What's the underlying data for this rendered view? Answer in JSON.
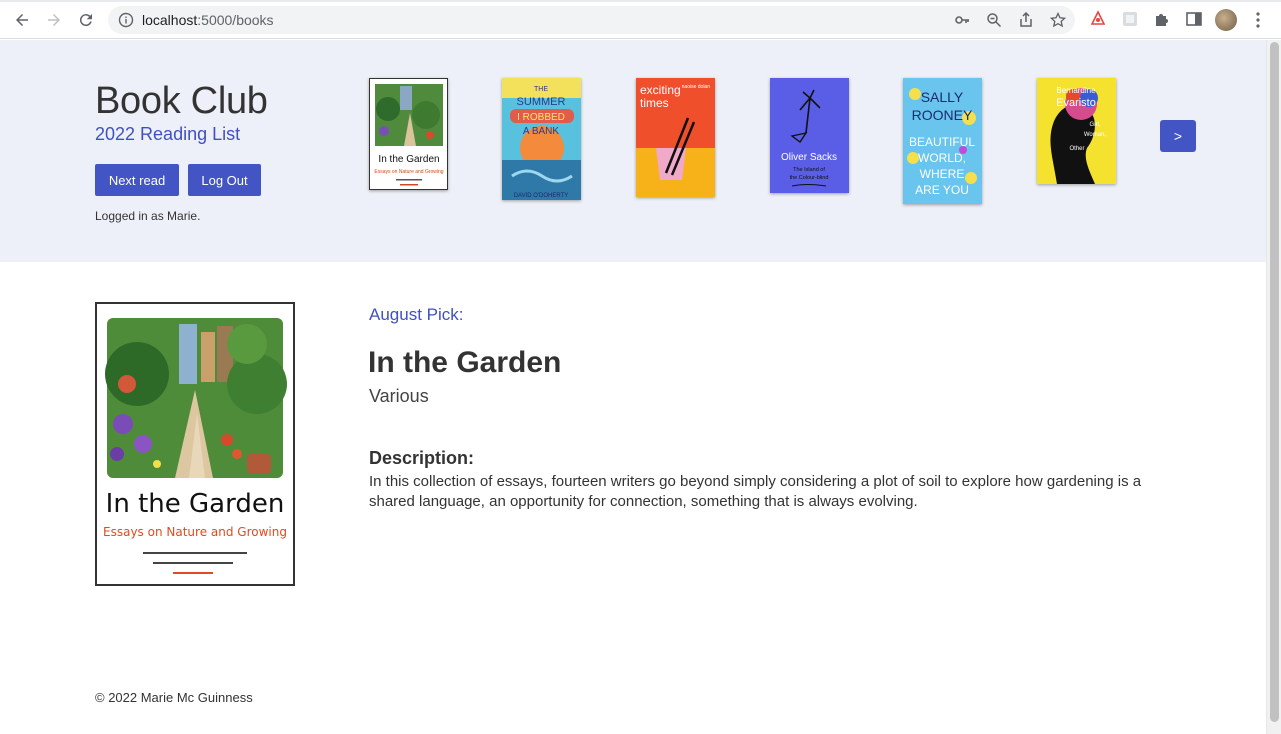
{
  "browser": {
    "url_host": "localhost",
    "url_path": ":5000/books"
  },
  "header": {
    "title": "Book Club",
    "subtitle": "2022 Reading List",
    "next_read_label": "Next read",
    "logout_label": "Log Out",
    "logged_in_text": "Logged in as Marie.",
    "carousel_next_label": ">"
  },
  "carousel": {
    "covers": [
      {
        "title_art": "In the Garden",
        "subtitle_art": "Essays on Nature and Growing"
      },
      {
        "title_art": "THE SUMMER I ROBBED A BANK",
        "author_art": "DAVID O'DOHERTY"
      },
      {
        "title_art": "exciting times",
        "author_art": "naoise dolan"
      },
      {
        "title_art": "Oliver Sacks",
        "subtitle_art": "The Island of the Colour-blind"
      },
      {
        "title_art": "SALLY ROONEY BEAUTIFUL WORLD, WHERE ARE YOU"
      },
      {
        "title_art": "Bernardine Evaristo",
        "subtitle_art": "Girl, Woman, Other"
      }
    ]
  },
  "featured": {
    "pick_label": "August Pick:",
    "title": "In the Garden",
    "author": "Various",
    "description_heading": "Description:",
    "description": "In this collection of essays, fourteen writers go beyond simply considering a plot of soil to explore how gardening is a shared language, an opportunity for connection, something that is always evolving.",
    "cover_title_art": "In the Garden",
    "cover_subtitle_art": "Essays on Nature and Growing"
  },
  "footer": {
    "copyright": "© 2022 Marie Mc Guinness"
  },
  "colors": {
    "accent": "#4354c4",
    "hero_bg": "#eef0f9"
  }
}
